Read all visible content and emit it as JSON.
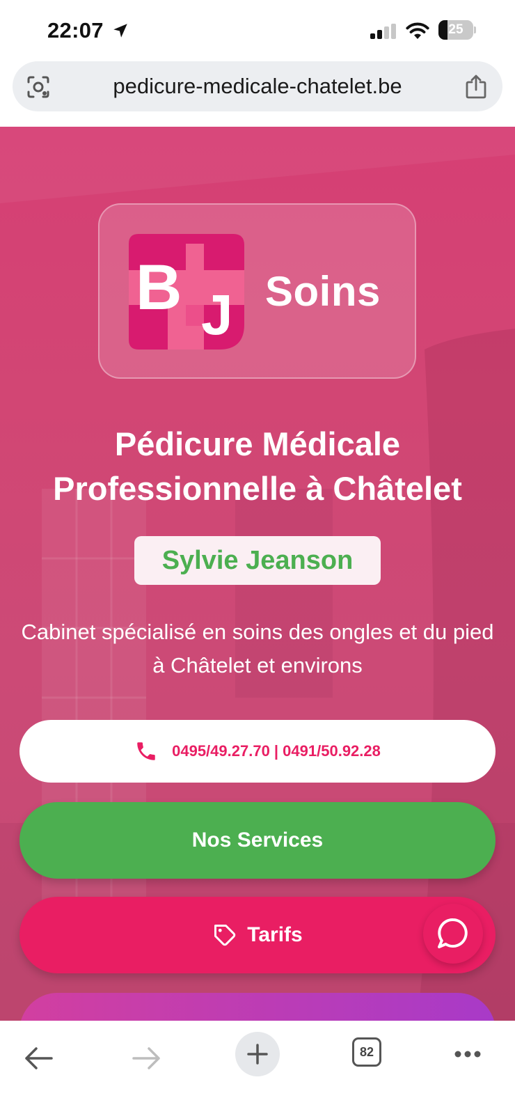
{
  "status_bar": {
    "time": "22:07",
    "battery": "25",
    "battery_level": 0.25,
    "icons": [
      "location-arrow-icon",
      "cellular-signal-icon",
      "wifi-icon",
      "battery-icon"
    ]
  },
  "browser": {
    "url": "pedicure-medicale-chatelet.be",
    "toolbar": {
      "tab_count": "82"
    },
    "icons": [
      "lens-icon",
      "share-icon",
      "back-arrow-icon",
      "forward-arrow-icon",
      "plus-icon",
      "more-icon"
    ]
  },
  "hero": {
    "logo": {
      "word": "Soins",
      "letters": [
        "B",
        "J"
      ]
    },
    "title": "Pédicure Médicale Professionnelle à Châtelet",
    "name": "Sylvie Jeanson",
    "subtitle": "Cabinet spécialisé en soins des ongles et du pied à Châtelet et environs",
    "phone_label": "0495/49.27.70 | 0491/50.92.28",
    "services_label": "Nos Services",
    "tarifs_label": "Tarifs"
  },
  "colors": {
    "hero_pink": "#d63f74",
    "accent_pink": "#e91e63",
    "green": "#4caf50",
    "badge_bg": "#fbeff3",
    "purple_gradient_end": "#a83ac8"
  }
}
